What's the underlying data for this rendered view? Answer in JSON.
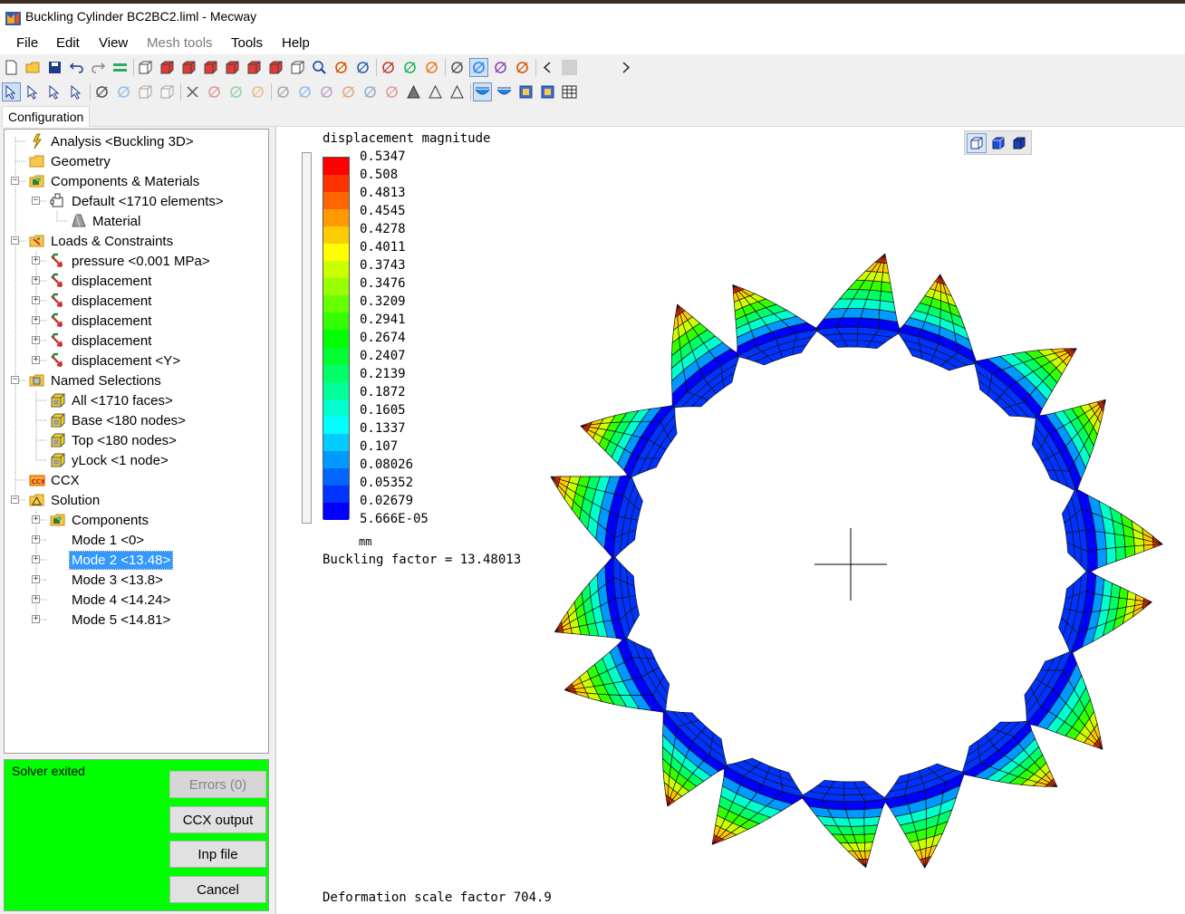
{
  "window": {
    "title": "Buckling Cylinder BC2BC2.liml - Mecway"
  },
  "menu": [
    {
      "label": "File",
      "enabled": true
    },
    {
      "label": "Edit",
      "enabled": true
    },
    {
      "label": "View",
      "enabled": true
    },
    {
      "label": "Mesh tools",
      "enabled": false
    },
    {
      "label": "Tools",
      "enabled": true
    },
    {
      "label": "Help",
      "enabled": true
    }
  ],
  "toolbar1_icons": [
    "new-file-icon",
    "open-folder-icon",
    "save-icon",
    "undo-icon",
    "redo-icon",
    "layers-icon",
    "view-iso-icon",
    "view-front-icon",
    "view-back-icon",
    "view-left-icon",
    "view-right-icon",
    "view-top-icon",
    "view-bottom-icon",
    "zoom-box-icon",
    "zoom-icon",
    "rotate-icon",
    "pan-icon",
    "paint-icon",
    "measure-icon",
    "probe-icon",
    "surface-icon",
    "shaded-icon",
    "wireframe-icon",
    "mesh-icon",
    "scroll-left-icon",
    "blank-icon",
    "scroll-right-icon"
  ],
  "toolbar2_icons": [
    "select-arrow-icon",
    "select-node-icon",
    "select-face-icon",
    "select-element-icon",
    "explode-icon",
    "extrude-icon",
    "box-icon",
    "cube-icon",
    "close-icon",
    "refine-icon",
    "split-icon",
    "merge-icon",
    "move-icon",
    "copy-icon",
    "revolve-icon",
    "sweep-icon",
    "branch-icon",
    "nodes-icon",
    "triangle-fill-icon",
    "triangle-icon",
    "triangle-outline-icon",
    "deformed-shape-icon",
    "undeformed-shape-icon",
    "animate-icon",
    "movie-icon",
    "table-icon"
  ],
  "tabs": [
    {
      "label": "Configuration"
    }
  ],
  "tree": [
    {
      "id": "analysis",
      "label": "Analysis <Buckling 3D>",
      "icon": "lightning-icon"
    },
    {
      "id": "geometry",
      "label": "Geometry",
      "icon": "folder-icon"
    },
    {
      "id": "components",
      "label": "Components & Materials",
      "icon": "components-folder-icon"
    },
    {
      "id": "default",
      "label": "Default <1710 elements>",
      "icon": "component-icon"
    },
    {
      "id": "material",
      "label": "Material",
      "icon": "material-icon"
    },
    {
      "id": "loads",
      "label": "Loads & Constraints",
      "icon": "loads-folder-icon"
    },
    {
      "id": "pressure",
      "label": "pressure <0.001 MPa>",
      "icon": "load-arrow-icon"
    },
    {
      "id": "disp1",
      "label": "displacement",
      "icon": "load-arrow-icon"
    },
    {
      "id": "disp2",
      "label": "displacement",
      "icon": "load-arrow-icon"
    },
    {
      "id": "disp3",
      "label": "displacement",
      "icon": "load-arrow-icon"
    },
    {
      "id": "disp4",
      "label": "displacement",
      "icon": "load-arrow-icon"
    },
    {
      "id": "disp5",
      "label": "displacement <Y>",
      "icon": "load-arrow-icon"
    },
    {
      "id": "named",
      "label": "Named Selections",
      "icon": "selection-folder-icon"
    },
    {
      "id": "all",
      "label": "All <1710 faces>",
      "icon": "selection-icon"
    },
    {
      "id": "base",
      "label": "Base <180 nodes>",
      "icon": "selection-icon"
    },
    {
      "id": "top",
      "label": "Top <180 nodes>",
      "icon": "selection-icon"
    },
    {
      "id": "ylock",
      "label": "yLock <1 node>",
      "icon": "selection-icon"
    },
    {
      "id": "ccx",
      "label": "CCX",
      "icon": "ccx-icon"
    },
    {
      "id": "solution",
      "label": "Solution",
      "icon": "solution-icon"
    },
    {
      "id": "sol-components",
      "label": "Components",
      "icon": "components-folder-icon"
    },
    {
      "id": "mode1",
      "label": "Mode 1 <0>",
      "icon": ""
    },
    {
      "id": "mode2",
      "label": "Mode 2 <13.48>",
      "icon": "",
      "selected": true
    },
    {
      "id": "mode3",
      "label": "Mode 3 <13.8>",
      "icon": ""
    },
    {
      "id": "mode4",
      "label": "Mode 4 <14.24>",
      "icon": ""
    },
    {
      "id": "mode5",
      "label": "Mode 5 <14.81>",
      "icon": ""
    }
  ],
  "solver": {
    "status": "Solver exited",
    "status_color": "#00ff00",
    "buttons": [
      {
        "label": "Errors (0)",
        "enabled": false
      },
      {
        "label": "CCX output",
        "enabled": true
      },
      {
        "label": "Inp file",
        "enabled": true
      },
      {
        "label": "Cancel",
        "enabled": true
      }
    ]
  },
  "viewport": {
    "legend_title": "displacement magnitude",
    "legend_values": [
      "0.5347",
      "0.508",
      "0.4813",
      "0.4545",
      "0.4278",
      "0.4011",
      "0.3743",
      "0.3476",
      "0.3209",
      "0.2941",
      "0.2674",
      "0.2407",
      "0.2139",
      "0.1872",
      "0.1605",
      "0.1337",
      "0.107",
      "0.08026",
      "0.05352",
      "0.02679",
      "5.666E-05"
    ],
    "legend_colors": [
      "#ff0000",
      "#ff3300",
      "#ff6600",
      "#ff9900",
      "#ffcc00",
      "#ffff00",
      "#ccff00",
      "#99ff00",
      "#66ff00",
      "#33ff00",
      "#00ff00",
      "#00ff33",
      "#00ff66",
      "#00ff99",
      "#00ffcc",
      "#00ffff",
      "#00ccff",
      "#0099ff",
      "#0066ff",
      "#0033ff",
      "#0000ff"
    ],
    "unit": "mm",
    "buckling_text": "Buckling factor = 13.48013",
    "deformation_text": "Deformation scale factor 704.9",
    "view_buttons": [
      "view-normal-icon",
      "view-blue-cube-icon",
      "view-dark-cube-icon"
    ],
    "lobe_count": 18
  }
}
